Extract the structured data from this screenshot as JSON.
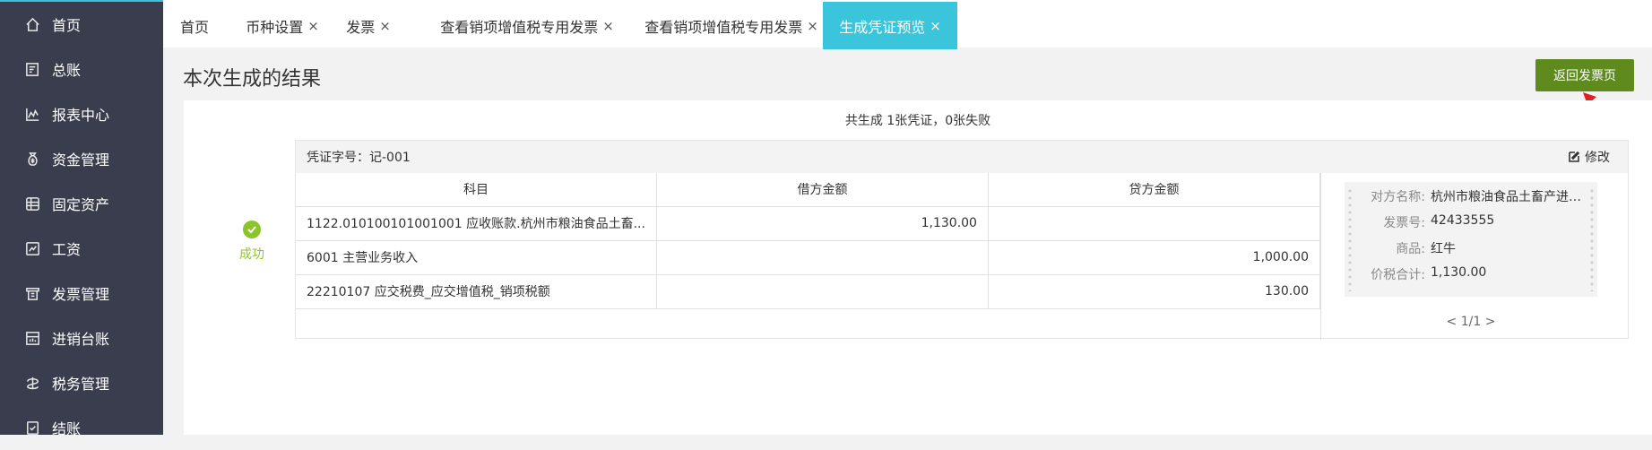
{
  "sidebar": {
    "items": [
      {
        "label": "首页",
        "icon": "home-icon"
      },
      {
        "label": "总账",
        "icon": "ledger-icon"
      },
      {
        "label": "报表中心",
        "icon": "report-chart-icon"
      },
      {
        "label": "资金管理",
        "icon": "money-bag-icon"
      },
      {
        "label": "固定资产",
        "icon": "assets-icon"
      },
      {
        "label": "工资",
        "icon": "salary-icon"
      },
      {
        "label": "发票管理",
        "icon": "invoice-icon"
      },
      {
        "label": "进销台账",
        "icon": "purchase-sales-icon"
      },
      {
        "label": "税务管理",
        "icon": "tax-icon"
      },
      {
        "label": "结账",
        "icon": "checkout-icon"
      }
    ]
  },
  "tabs": [
    {
      "label": "首页",
      "closable": false
    },
    {
      "label": "币种设置",
      "closable": true
    },
    {
      "label": "发票",
      "closable": true
    },
    {
      "label": "查看销项增值税专用发票",
      "closable": true
    },
    {
      "label": "查看销项增值税专用发票",
      "closable": true
    },
    {
      "label": "生成凭证预览",
      "closable": true,
      "active": true
    }
  ],
  "tab_close_glyph": "×",
  "page": {
    "title": "本次生成的结果",
    "back_button": "返回发票页",
    "summary": "共生成 1张凭证，0张失败"
  },
  "result": {
    "status_label": "成功",
    "voucher_no": "凭证字号：记-001",
    "edit_label": "修改",
    "columns": [
      "科目",
      "借方金额",
      "贷方金额"
    ],
    "rows": [
      {
        "account": "1122.010100101001001 应收账款.杭州市粮油食品土畜...",
        "debit": "1,130.00",
        "credit": ""
      },
      {
        "account": "6001 主营业务收入",
        "debit": "",
        "credit": "1,000.00"
      },
      {
        "account": "22210107 应交税费_应交增值税_销项税额",
        "debit": "",
        "credit": "130.00"
      }
    ]
  },
  "invoice": {
    "counterparty_key": "对方名称:",
    "counterparty": "杭州市粮油食品土畜产进出...",
    "invoice_no_key": "发票号:",
    "invoice_no": "42433555",
    "goods_key": "商品:",
    "goods": "红牛",
    "total_key": "价税合计:",
    "total": "1,130.00",
    "pager": "< 1/1 >"
  },
  "colors": {
    "sidebar_bg": "#3a3d4d",
    "active_tab": "#3bc5dc",
    "back_button": "#5e8a1e",
    "success": "#8bc52a",
    "annotation_arrow": "#e02020"
  }
}
